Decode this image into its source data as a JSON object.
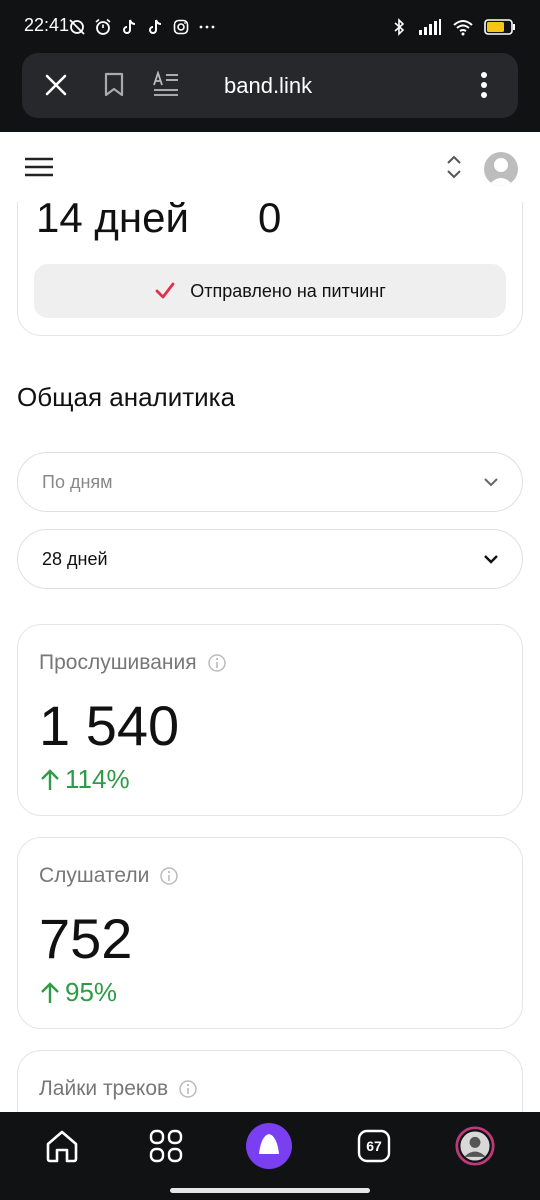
{
  "status_bar": {
    "time": "22:41",
    "battery": "71"
  },
  "browser": {
    "url": "band.link"
  },
  "summary_card": {
    "days_value": "14 дней",
    "second_value": "0",
    "pitch_status": "Отправлено на питчинг"
  },
  "analytics": {
    "title": "Общая аналитика",
    "grouping_placeholder": "По дням",
    "period_value": "28 дней",
    "metrics": [
      {
        "label": "Прослушивания",
        "value": "1 540",
        "delta": "114%"
      },
      {
        "label": "Слушатели",
        "value": "752",
        "delta": "95%"
      },
      {
        "label": "Лайки треков"
      }
    ]
  },
  "bottom_nav": {
    "tabs_count": "67"
  },
  "colors": {
    "accent_green": "#2e9b46",
    "check_red": "#e0304a",
    "alice_purple": "#7b3ff2"
  }
}
